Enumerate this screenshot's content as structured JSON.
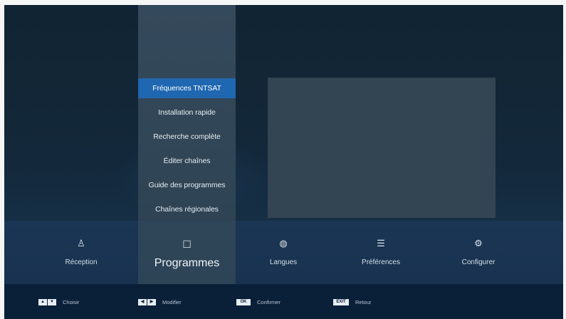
{
  "submenu": {
    "items": [
      {
        "label": "Fréquences TNTSAT",
        "active": true
      },
      {
        "label": "Installation rapide",
        "active": false
      },
      {
        "label": "Recherche complète",
        "active": false
      },
      {
        "label": "Éditer chaînes",
        "active": false
      },
      {
        "label": "Guide des programmes",
        "active": false
      },
      {
        "label": "Chaînes régionales",
        "active": false
      }
    ]
  },
  "nav": {
    "items": [
      {
        "label": "Réception",
        "icon": "antenna-icon",
        "glyph": "♙",
        "active": false
      },
      {
        "label": "Programmes",
        "icon": "programs-icon",
        "glyph": "☐",
        "active": true
      },
      {
        "label": "Langues",
        "icon": "globe-icon",
        "glyph": "◍",
        "active": false
      },
      {
        "label": "Préférences",
        "icon": "list-icon",
        "glyph": "☰",
        "active": false
      },
      {
        "label": "Configurer",
        "icon": "gear-icon",
        "glyph": "⚙",
        "active": false
      }
    ]
  },
  "footer": {
    "hints": [
      {
        "keys": [
          "▲",
          "▼"
        ],
        "label": "Choisir"
      },
      {
        "keys": [
          "◀",
          "▶"
        ],
        "label": "Modifier"
      },
      {
        "keys": [
          "OK"
        ],
        "label": "Confirmer"
      },
      {
        "keys": [
          "EXIT"
        ],
        "label": "Retour"
      }
    ]
  },
  "colors": {
    "accent": "#1f67b0",
    "background": "#102231",
    "panel": "#304555",
    "nav": "#183250",
    "footer": "#0a1f38"
  }
}
